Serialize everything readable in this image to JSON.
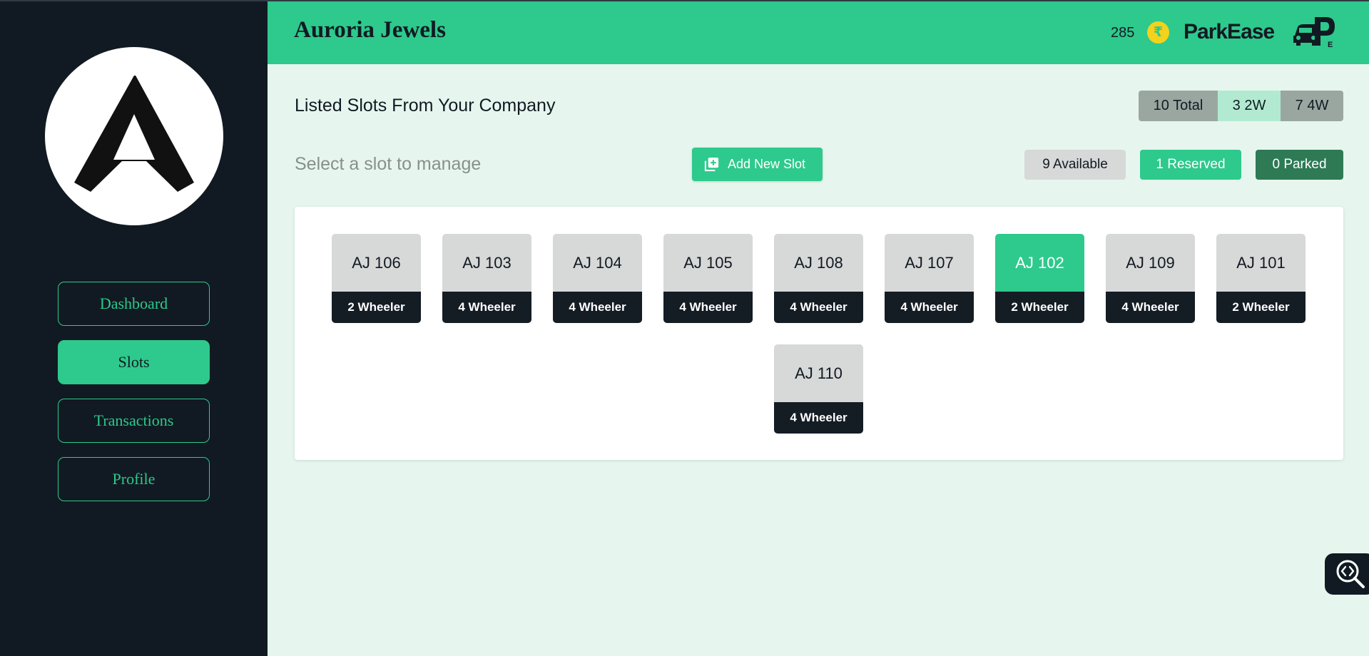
{
  "header": {
    "company_name": "Auroria Jewels",
    "coins": "285",
    "coin_symbol": "₹",
    "app_name": "ParkEase"
  },
  "sidebar": {
    "items": [
      {
        "label": "Dashboard",
        "active": false
      },
      {
        "label": "Slots",
        "active": true
      },
      {
        "label": "Transactions",
        "active": false
      },
      {
        "label": "Profile",
        "active": false
      }
    ]
  },
  "main": {
    "title": "Listed Slots From Your Company",
    "counts": {
      "total": "10 Total",
      "two_wheeler": "3 2W",
      "four_wheeler": "7 4W"
    },
    "select_hint": "Select a slot to manage",
    "add_button": "Add New Slot",
    "status": {
      "available": "9 Available",
      "reserved": "1 Reserved",
      "parked": "0 Parked"
    },
    "slots": [
      {
        "name": "AJ 106",
        "type": "2 Wheeler",
        "status": "available"
      },
      {
        "name": "AJ 103",
        "type": "4 Wheeler",
        "status": "available"
      },
      {
        "name": "AJ 104",
        "type": "4 Wheeler",
        "status": "available"
      },
      {
        "name": "AJ 105",
        "type": "4 Wheeler",
        "status": "available"
      },
      {
        "name": "AJ 108",
        "type": "4 Wheeler",
        "status": "available"
      },
      {
        "name": "AJ 107",
        "type": "4 Wheeler",
        "status": "available"
      },
      {
        "name": "AJ 102",
        "type": "2 Wheeler",
        "status": "reserved"
      },
      {
        "name": "AJ 109",
        "type": "4 Wheeler",
        "status": "available"
      },
      {
        "name": "AJ 101",
        "type": "2 Wheeler",
        "status": "available"
      },
      {
        "name": "AJ 110",
        "type": "4 Wheeler",
        "status": "available"
      }
    ]
  },
  "colors": {
    "accent": "#2ec98c",
    "sidebar_bg": "#111a22",
    "main_bg": "#e6f6ee",
    "parked": "#2d7a55",
    "coin": "#f4d21c"
  },
  "icons": {
    "company_logo": "apex-logo-icon",
    "coin": "rupee-coin-icon",
    "app_logo": "parking-car-icon",
    "add": "add-box-icon",
    "float": "code-search-icon"
  }
}
